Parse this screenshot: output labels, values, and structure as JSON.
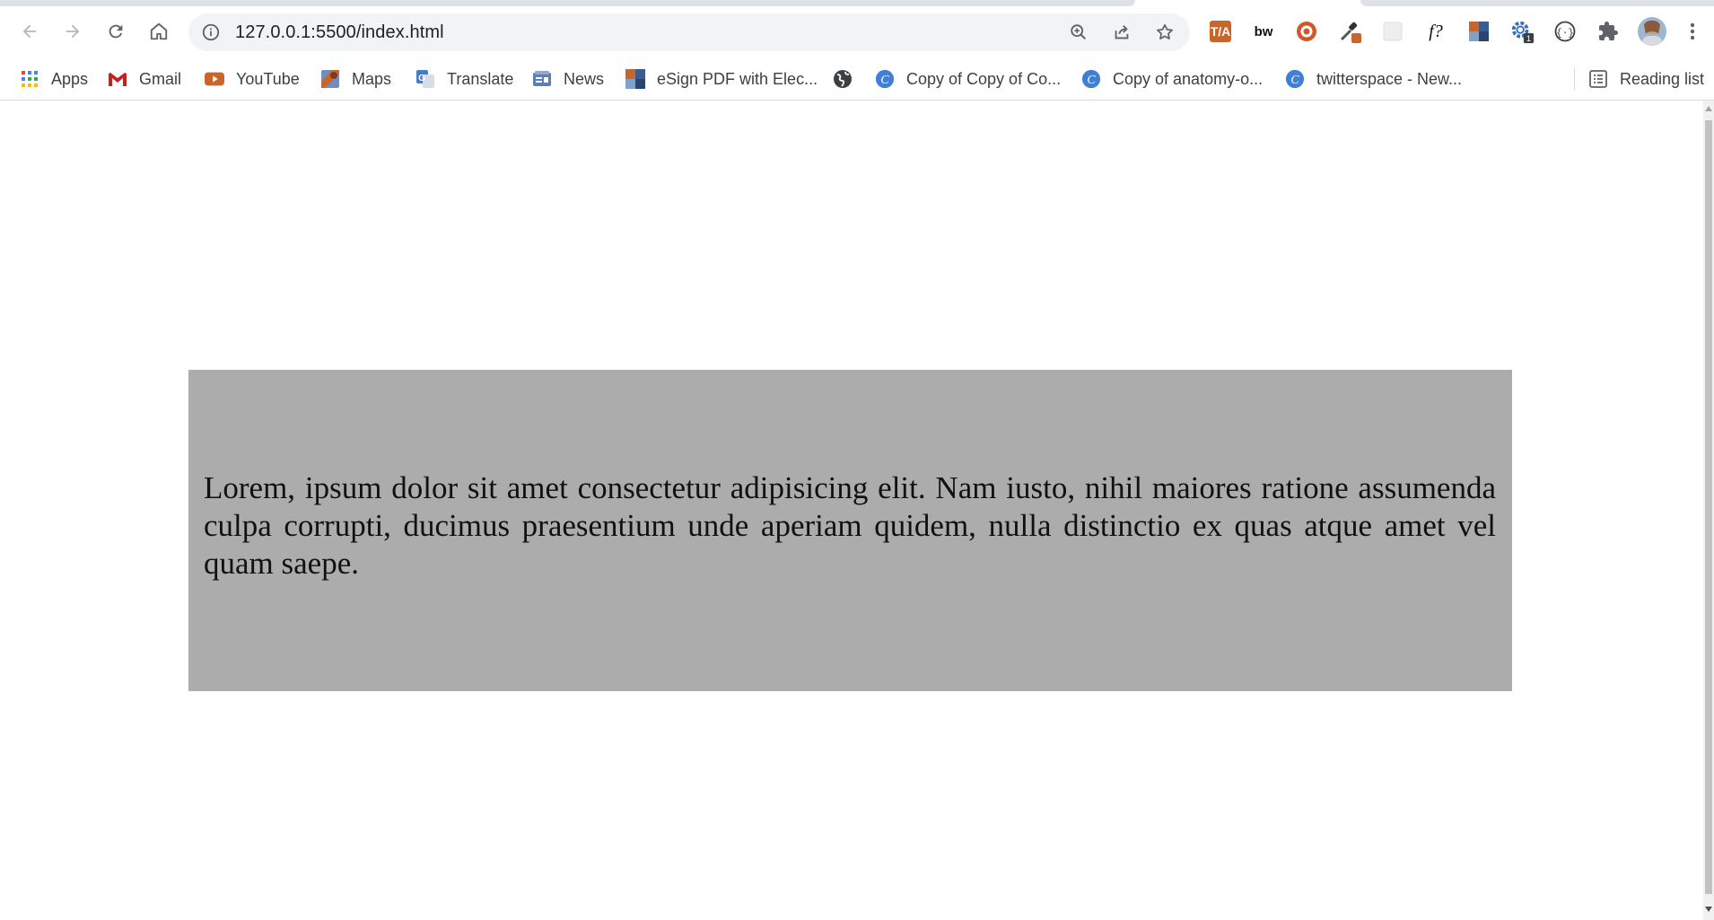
{
  "browser": {
    "url": "127.0.0.1:5500/index.html"
  },
  "bookmarks": [
    {
      "label": "Apps",
      "icon": "apps-grid-icon"
    },
    {
      "label": "Gmail",
      "icon": "gmail-icon"
    },
    {
      "label": "YouTube",
      "icon": "youtube-icon"
    },
    {
      "label": "Maps",
      "icon": "maps-icon"
    },
    {
      "label": "Translate",
      "icon": "translate-icon"
    },
    {
      "label": "News",
      "icon": "news-icon"
    },
    {
      "label": "eSign PDF with Elec...",
      "icon": "esign-icon"
    },
    {
      "label": "",
      "icon": "globe-icon"
    },
    {
      "label": "Copy of Copy of Co...",
      "icon": "canva-icon"
    },
    {
      "label": "Copy of anatomy-o...",
      "icon": "canva-icon"
    },
    {
      "label": "twitterspace - New...",
      "icon": "canva-icon"
    }
  ],
  "reading_list": {
    "label": "Reading list"
  },
  "page": {
    "paragraph": "Lorem, ipsum dolor sit amet consectetur adipisicing elit. Nam iusto, nihil maiores ratione assumenda culpa corrupti, ducimus praesentium unde aperiam quidem, nulla distinctio ex quas atque amet vel quam saepe."
  },
  "extensions": [
    {
      "icon": "translate-ext-icon",
      "badge": ""
    },
    {
      "icon": "bw-ext-icon",
      "badge": ""
    },
    {
      "icon": "target-ext-icon",
      "badge": ""
    },
    {
      "icon": "eyedropper-ext-icon",
      "badge": ""
    },
    {
      "icon": "blank-ext-icon",
      "badge": ""
    },
    {
      "icon": "font-detect-ext-icon",
      "badge": ""
    },
    {
      "icon": "color-grid-ext-icon",
      "badge": ""
    },
    {
      "icon": "gear-ext-icon",
      "badge": "1"
    },
    {
      "icon": "code-ext-icon",
      "badge": ""
    }
  ],
  "colors": {
    "box_bg": "#acacac",
    "page_bg": "#ffffff",
    "omnibox_bg": "#f1f3f4"
  }
}
